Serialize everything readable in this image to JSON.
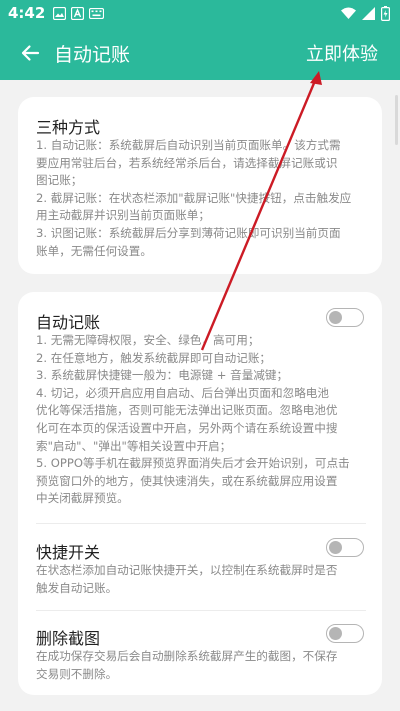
{
  "status_bar": {
    "time": "4:42",
    "icons_left": [
      "image-icon",
      "a-badge-icon",
      "keyboard-icon"
    ],
    "icons_right": [
      "wifi-icon",
      "signal-icon",
      "battery-charging-icon"
    ]
  },
  "app_bar": {
    "back_icon": "arrow-left-icon",
    "title": "自动记账",
    "action_label": "立即体验"
  },
  "card_modes": {
    "title": "三种方式",
    "lines": [
      "1. 自动记账：系统截屏后自动识别当前页面账单。该方式需",
      "要应用常驻后台，若系统经常杀后台，请选择截屏记账或识",
      "图记账；",
      "2. 截屏记账：在状态栏添加\"截屏记账\"快捷按钮，点击触发应",
      "用主动截屏并识别当前页面账单；",
      "3. 识图记账：系统截屏后分享到薄荷记账即可识别当前页面",
      "账单，无需任何设置。"
    ]
  },
  "card_settings": {
    "auto": {
      "title": "自动记账",
      "enabled": false,
      "lines": [
        "1. 无需无障碍权限，安全、绿色，高可用；",
        "2. 在任意地方，触发系统截屏即可自动记账；",
        "3. 系统截屏快捷键一般为：电源键 + 音量减键；",
        "4. 切记，必须开启应用自启动、后台弹出页面和忽略电池",
        "优化等保活措施，否则可能无法弹出记账页面。忽略电池优",
        "化可在本页的保活设置中开启，另外两个请在系统设置中搜",
        "索\"启动\"、\"弹出\"等相关设置中开启；",
        "5. OPPO等手机在截屏预览界面消失后才会开始识别，可点击",
        "预览窗口外的地方，使其快速消失，或在系统截屏应用设置",
        "中关闭截屏预览。"
      ]
    },
    "shortcut": {
      "title": "快捷开关",
      "enabled": false,
      "lines": [
        "在状态栏添加自动记账快捷开关，以控制在系统截屏时是否",
        "触发自动记账。"
      ]
    },
    "delete": {
      "title": "删除截图",
      "enabled": false,
      "lines": [
        "在成功保存交易后会自动删除系统截屏产生的截图，不保存",
        "交易则不删除。"
      ]
    }
  },
  "colors": {
    "primary": "#2bb99b",
    "annotation_arrow": "#cc1b25",
    "text_primary": "#222222",
    "text_secondary": "#8a8a8a"
  }
}
